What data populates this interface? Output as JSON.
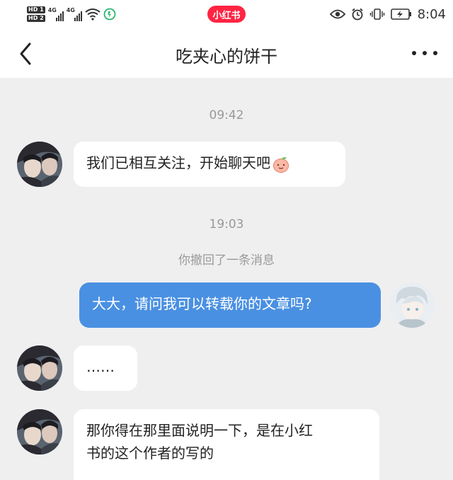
{
  "status_bar": {
    "hd1": "HD 1",
    "hd2": "HD 2",
    "net1": "4G",
    "net2": "4G",
    "app_badge": "小红书",
    "time": "8:04"
  },
  "header": {
    "title": "吃夹心的饼干"
  },
  "messages": [
    {
      "kind": "time",
      "text": "09:42"
    },
    {
      "kind": "received",
      "text": "我们已相互关注，开始聊天吧",
      "emoji": "peach-emoji"
    },
    {
      "kind": "time",
      "text": "19:03"
    },
    {
      "kind": "system",
      "text": "你撤回了一条消息"
    },
    {
      "kind": "sent",
      "text": "大大，请问我可以转载你的文章吗?"
    },
    {
      "kind": "received",
      "text": "……"
    },
    {
      "kind": "received",
      "text_line1": "那你得在那里面说明一下，是在小红",
      "text_line2": "书的这个作者的写的"
    }
  ],
  "colors": {
    "accent": "#ff2442",
    "sent_bubble": "#4a90e2",
    "background": "#efeff0"
  }
}
